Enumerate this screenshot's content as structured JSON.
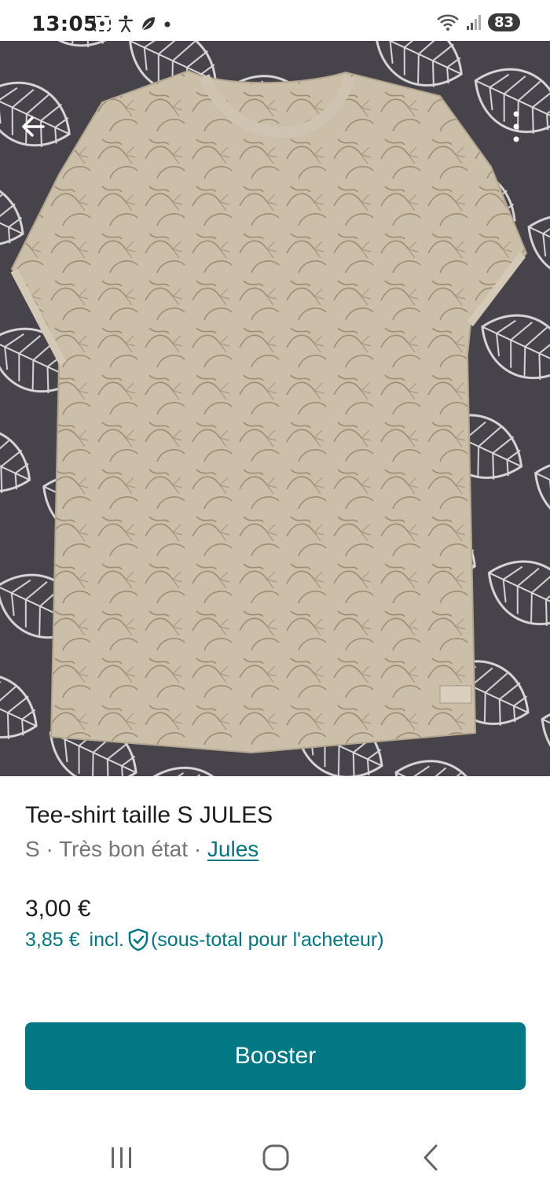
{
  "status_bar": {
    "time": "13:05",
    "battery": "83",
    "left_icons": [
      "screenshot-icon",
      "accessibility-icon",
      "leaf-icon",
      "dot-icon"
    ],
    "right_icons": [
      "wifi-icon",
      "signal-icon",
      "battery-icon"
    ]
  },
  "photo": {
    "description_icon": "tshirt-photo",
    "colors": {
      "shirt": "#c9bba5",
      "background": "#4a474c"
    }
  },
  "listing": {
    "title": "Tee-shirt taille S JULES",
    "size": "S",
    "condition": "Très bon état",
    "separator": "·",
    "brand": "Jules",
    "price": "3,00 €",
    "price_incl": "3,85 €",
    "incl_label": "incl.",
    "buyer_note": "(sous-total pour l'acheteur)"
  },
  "actions": {
    "booster_label": "Booster"
  },
  "colors": {
    "accent": "#007782",
    "button": "#017883"
  },
  "navbar": {
    "icons": [
      "recent-apps-icon",
      "home-icon",
      "back-icon"
    ]
  }
}
